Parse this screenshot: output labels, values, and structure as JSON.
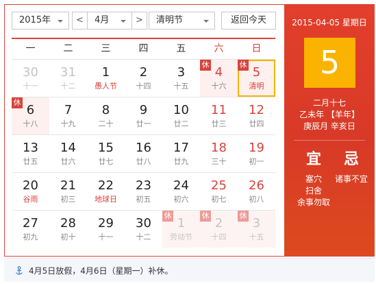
{
  "controls": {
    "year": "2015年",
    "prev": "<",
    "month": "4月",
    "next": ">",
    "holiday": "清明节",
    "today_button": "返回今天"
  },
  "weekdays": [
    "一",
    "二",
    "三",
    "四",
    "五",
    "六",
    "日"
  ],
  "rest_tag": "休",
  "weeks": [
    [
      {
        "day": "30",
        "lunar": "十一",
        "other": true
      },
      {
        "day": "31",
        "lunar": "十二",
        "other": true
      },
      {
        "day": "1",
        "lunar": "愚人节",
        "fest": true
      },
      {
        "day": "2",
        "lunar": "十四"
      },
      {
        "day": "3",
        "lunar": "十五"
      },
      {
        "day": "4",
        "lunar": "十六",
        "weekend": true,
        "rest": true
      },
      {
        "day": "5",
        "lunar": "清明",
        "weekend": true,
        "rest": true,
        "fest": true,
        "selected": true
      }
    ],
    [
      {
        "day": "6",
        "lunar": "十八",
        "rest": true
      },
      {
        "day": "7",
        "lunar": "十九"
      },
      {
        "day": "8",
        "lunar": "二十"
      },
      {
        "day": "9",
        "lunar": "廿一"
      },
      {
        "day": "10",
        "lunar": "廿二"
      },
      {
        "day": "11",
        "lunar": "廿三",
        "weekend": true
      },
      {
        "day": "12",
        "lunar": "廿四",
        "weekend": true
      }
    ],
    [
      {
        "day": "13",
        "lunar": "廿五"
      },
      {
        "day": "14",
        "lunar": "廿六"
      },
      {
        "day": "15",
        "lunar": "廿七"
      },
      {
        "day": "16",
        "lunar": "廿八"
      },
      {
        "day": "17",
        "lunar": "廿九"
      },
      {
        "day": "18",
        "lunar": "三十",
        "weekend": true
      },
      {
        "day": "19",
        "lunar": "初一",
        "weekend": true
      }
    ],
    [
      {
        "day": "20",
        "lunar": "谷雨",
        "fest": true
      },
      {
        "day": "21",
        "lunar": "初三"
      },
      {
        "day": "22",
        "lunar": "地球日",
        "fest": true
      },
      {
        "day": "23",
        "lunar": "初五"
      },
      {
        "day": "24",
        "lunar": "初六"
      },
      {
        "day": "25",
        "lunar": "初七",
        "weekend": true
      },
      {
        "day": "26",
        "lunar": "初八",
        "weekend": true
      }
    ],
    [
      {
        "day": "27",
        "lunar": "初九"
      },
      {
        "day": "28",
        "lunar": "初十"
      },
      {
        "day": "29",
        "lunar": "十一"
      },
      {
        "day": "30",
        "lunar": "十二"
      },
      {
        "day": "1",
        "lunar": "劳动节",
        "other": true,
        "rest": true
      },
      {
        "day": "2",
        "lunar": "十四",
        "other": true,
        "rest": true
      },
      {
        "day": "3",
        "lunar": "十五",
        "other": true,
        "rest": true
      }
    ]
  ],
  "panel": {
    "date_line": "2015-04-05 星期日",
    "big_day": "5",
    "lunar_date": "二月十七",
    "ganzhi_year": "乙未年 【羊年】",
    "ganzhi_month_day": "庚辰月 辛亥日",
    "yi_label": "宜",
    "ji_label": "忌",
    "yi_items": [
      "塞穴",
      "扫舍",
      "余事勿取"
    ],
    "ji_items": [
      "诸事不宜"
    ]
  },
  "footer": {
    "icon": "anchor-icon",
    "text": "4月5日放假，4月6日（星期一）补休。"
  },
  "colors": {
    "accent": "#d9423b",
    "highlight": "#f9b300",
    "rest_bg": "#fdf0ef"
  }
}
